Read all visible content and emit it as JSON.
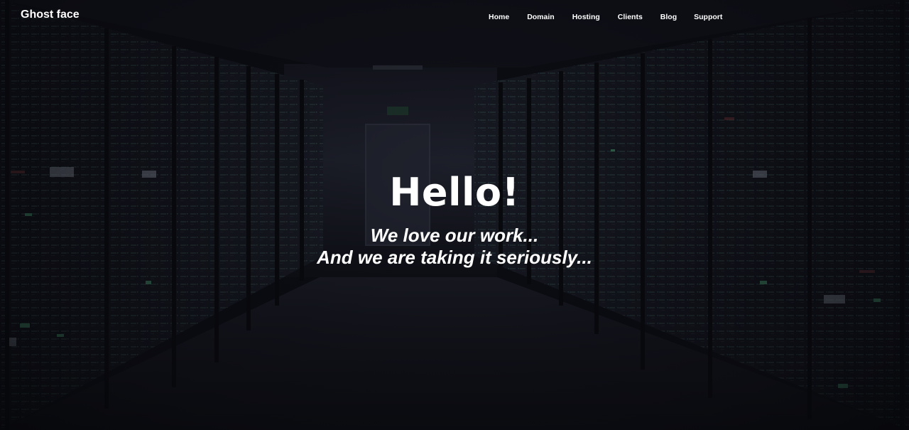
{
  "brand": {
    "name": "Ghost face"
  },
  "nav": {
    "items": [
      {
        "label": "Home"
      },
      {
        "label": "Domain"
      },
      {
        "label": "Hosting"
      },
      {
        "label": "Clients"
      },
      {
        "label": "Blog"
      },
      {
        "label": "Support"
      }
    ]
  },
  "hero": {
    "heading": "Hello!",
    "tagline_line1": "We love our work...",
    "tagline_line2": "And we are taking it seriously..."
  },
  "colors": {
    "background": "#0c0d14",
    "text": "#ffffff"
  }
}
